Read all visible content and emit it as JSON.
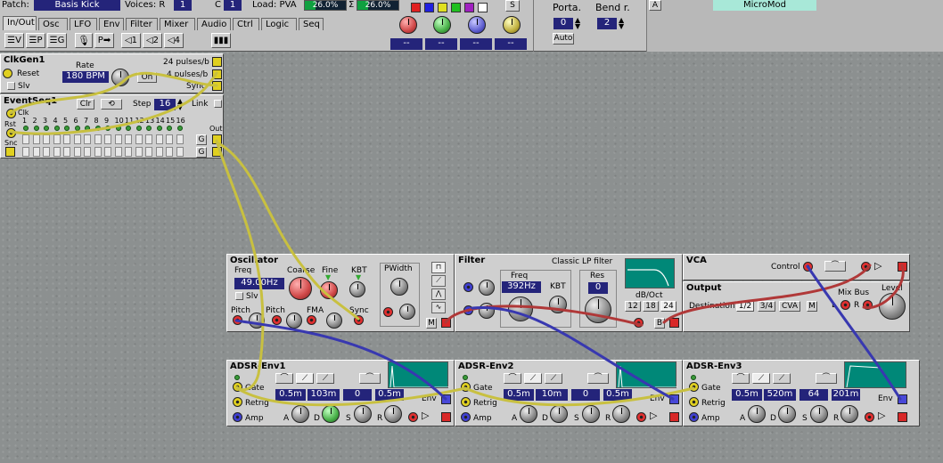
{
  "toolbar": {
    "patch_label": "Patch:",
    "patch_name": "Basis Kick",
    "voices_label": "Voices: R",
    "voices_r": "1",
    "voices_c_label": "C",
    "voices_c": "1",
    "load_label": "Load: PVA",
    "load_pva": "26.0%",
    "sigma_label": "Σ",
    "load_total": "26.0%",
    "load_pva_fraction": 0.26,
    "load_total_fraction": 0.26,
    "swatch_colors": [
      "#e02020",
      "#2020e0",
      "#e0e020",
      "#20c020",
      "#a020c0",
      "#ffffff"
    ],
    "s_button": "S",
    "tabs": [
      "In/Out",
      "Osc",
      "LFO",
      "Env",
      "Filter",
      "Mixer",
      "Audio",
      "Ctrl",
      "Logic",
      "Seq"
    ],
    "active_tab": "In/Out",
    "module_buttons": [
      "V",
      "P",
      "G",
      "",
      "P",
      "1",
      "2",
      "4",
      ""
    ],
    "morph_dashes": [
      "--",
      "--",
      "--",
      "--"
    ],
    "porta_label": "Porta.",
    "porta_value": "0",
    "porta_auto": "Auto",
    "bend_label": "Bend r.",
    "bend_value": "2",
    "a_button": "A",
    "micromod": "MicroMod"
  },
  "clkgen": {
    "title": "ClkGen1",
    "rate_label": "Rate",
    "rate_value": "180 BPM",
    "on_button": "On",
    "reset": "Reset",
    "slv": "Slv",
    "out_24": "24 pulses/b",
    "out_4": "4 pulses/b",
    "sync": "Sync"
  },
  "eventseq": {
    "title": "EventSeq1",
    "clr": "Clr",
    "step_label": "Step",
    "step_value": "16",
    "link": "Link",
    "clk": "Clk",
    "rst": "Rst",
    "snc": "Snc",
    "out": "Out",
    "g": "G",
    "step_numbers": [
      "1",
      "2",
      "3",
      "4",
      "5",
      "6",
      "7",
      "8",
      "9",
      "10",
      "11",
      "12",
      "13",
      "14",
      "15",
      "16"
    ]
  },
  "oscillator": {
    "title": "Oscillator",
    "freq_label": "Freq",
    "freq_value": "49.00Hz",
    "coarse": "Coarse",
    "fine": "Fine",
    "kbt": "KBT",
    "slv": "Slv",
    "pwidth": "PWidth",
    "pitch1": "Pitch",
    "pitch2": "Pitch",
    "fma": "FMA",
    "sync": "Sync",
    "m": "M"
  },
  "filter": {
    "title": "Filter",
    "subtitle": "Classic LP filter",
    "freq_label": "Freq",
    "freq_value": "392Hz",
    "kbt": "KBT",
    "res_label": "Res",
    "res_value": "0",
    "db_oct": "dB/Oct",
    "slopes": [
      "12",
      "18",
      "24"
    ],
    "b": "B"
  },
  "vca": {
    "title": "VCA",
    "control": "Control"
  },
  "output": {
    "title": "Output",
    "destination": "Destination",
    "dest_options": [
      "1/2",
      "3/4",
      "CVA"
    ],
    "mix_bus": "Mix Bus",
    "level": "Level",
    "m": "M",
    "l": "L",
    "r": "R"
  },
  "envs": [
    {
      "title": "ADSR-Env1",
      "a": "0.5m",
      "d": "103m",
      "s": "0",
      "r": "0.5m"
    },
    {
      "title": "ADSR-Env2",
      "a": "0.5m",
      "d": "10m",
      "s": "0",
      "r": "0.5m"
    },
    {
      "title": "ADSR-Env3",
      "a": "0.5m",
      "d": "520m",
      "s": "64",
      "r": "201m"
    }
  ],
  "env_labels": {
    "gate": "Gate",
    "retrig": "Retrig",
    "amp": "Amp",
    "a": "A",
    "d": "D",
    "s": "S",
    "r": "R",
    "env": "Env"
  }
}
